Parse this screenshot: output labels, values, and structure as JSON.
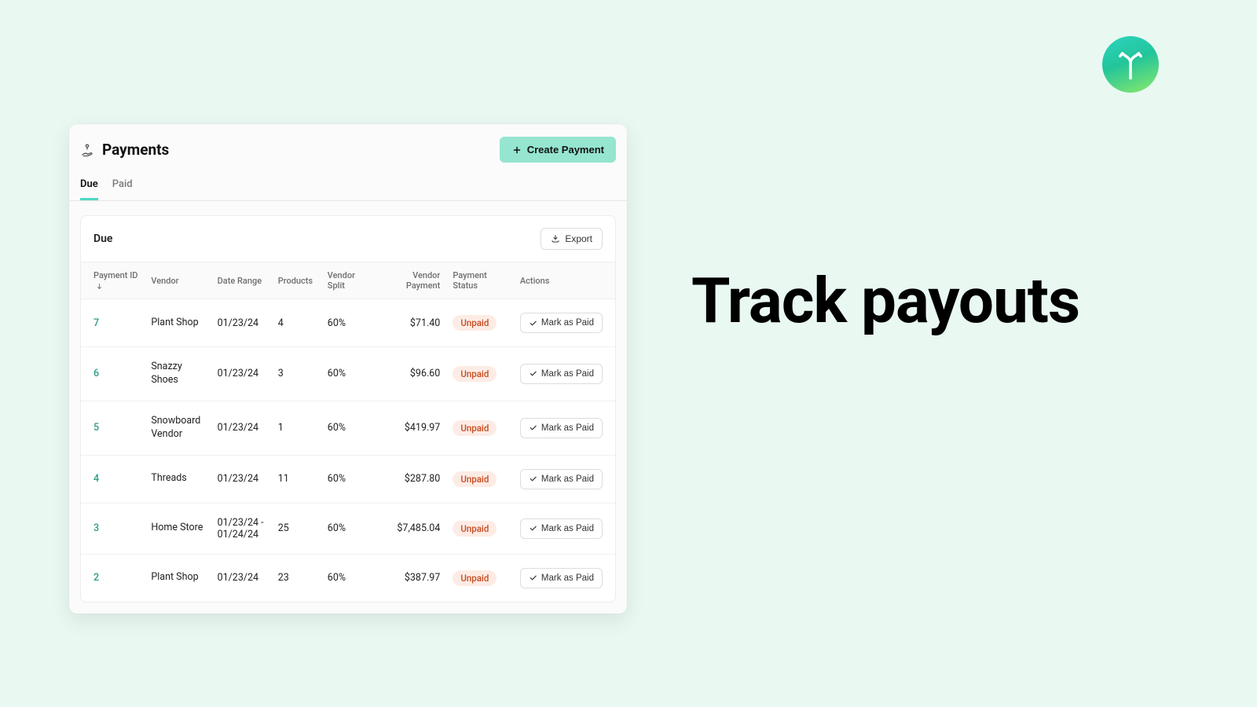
{
  "headline": "Track payouts",
  "header": {
    "title": "Payments",
    "create_label": "Create Payment"
  },
  "tabs": {
    "due": "Due",
    "paid": "Paid"
  },
  "section": {
    "title": "Due",
    "export_label": "Export"
  },
  "columns": {
    "id": "Payment ID",
    "vendor": "Vendor",
    "date": "Date Range",
    "products": "Products",
    "split": "Vendor Split",
    "payment": "Vendor Payment",
    "status": "Payment Status",
    "actions": "Actions"
  },
  "action_label": "Mark as Paid",
  "status_unpaid": "Unpaid",
  "rows": [
    {
      "id": "7",
      "vendor": "Plant Shop",
      "date": "01/23/24",
      "products": "4",
      "split": "60%",
      "payment": "$71.40"
    },
    {
      "id": "6",
      "vendor": "Snazzy Shoes",
      "date": "01/23/24",
      "products": "3",
      "split": "60%",
      "payment": "$96.60"
    },
    {
      "id": "5",
      "vendor": "Snowboard Vendor",
      "date": "01/23/24",
      "products": "1",
      "split": "60%",
      "payment": "$419.97"
    },
    {
      "id": "4",
      "vendor": "Threads",
      "date": "01/23/24",
      "products": "11",
      "split": "60%",
      "payment": "$287.80"
    },
    {
      "id": "3",
      "vendor": "Home Store",
      "date": "01/23/24 - 01/24/24",
      "products": "25",
      "split": "60%",
      "payment": "$7,485.04"
    },
    {
      "id": "2",
      "vendor": "Plant Shop",
      "date": "01/23/24",
      "products": "23",
      "split": "60%",
      "payment": "$387.97"
    }
  ]
}
